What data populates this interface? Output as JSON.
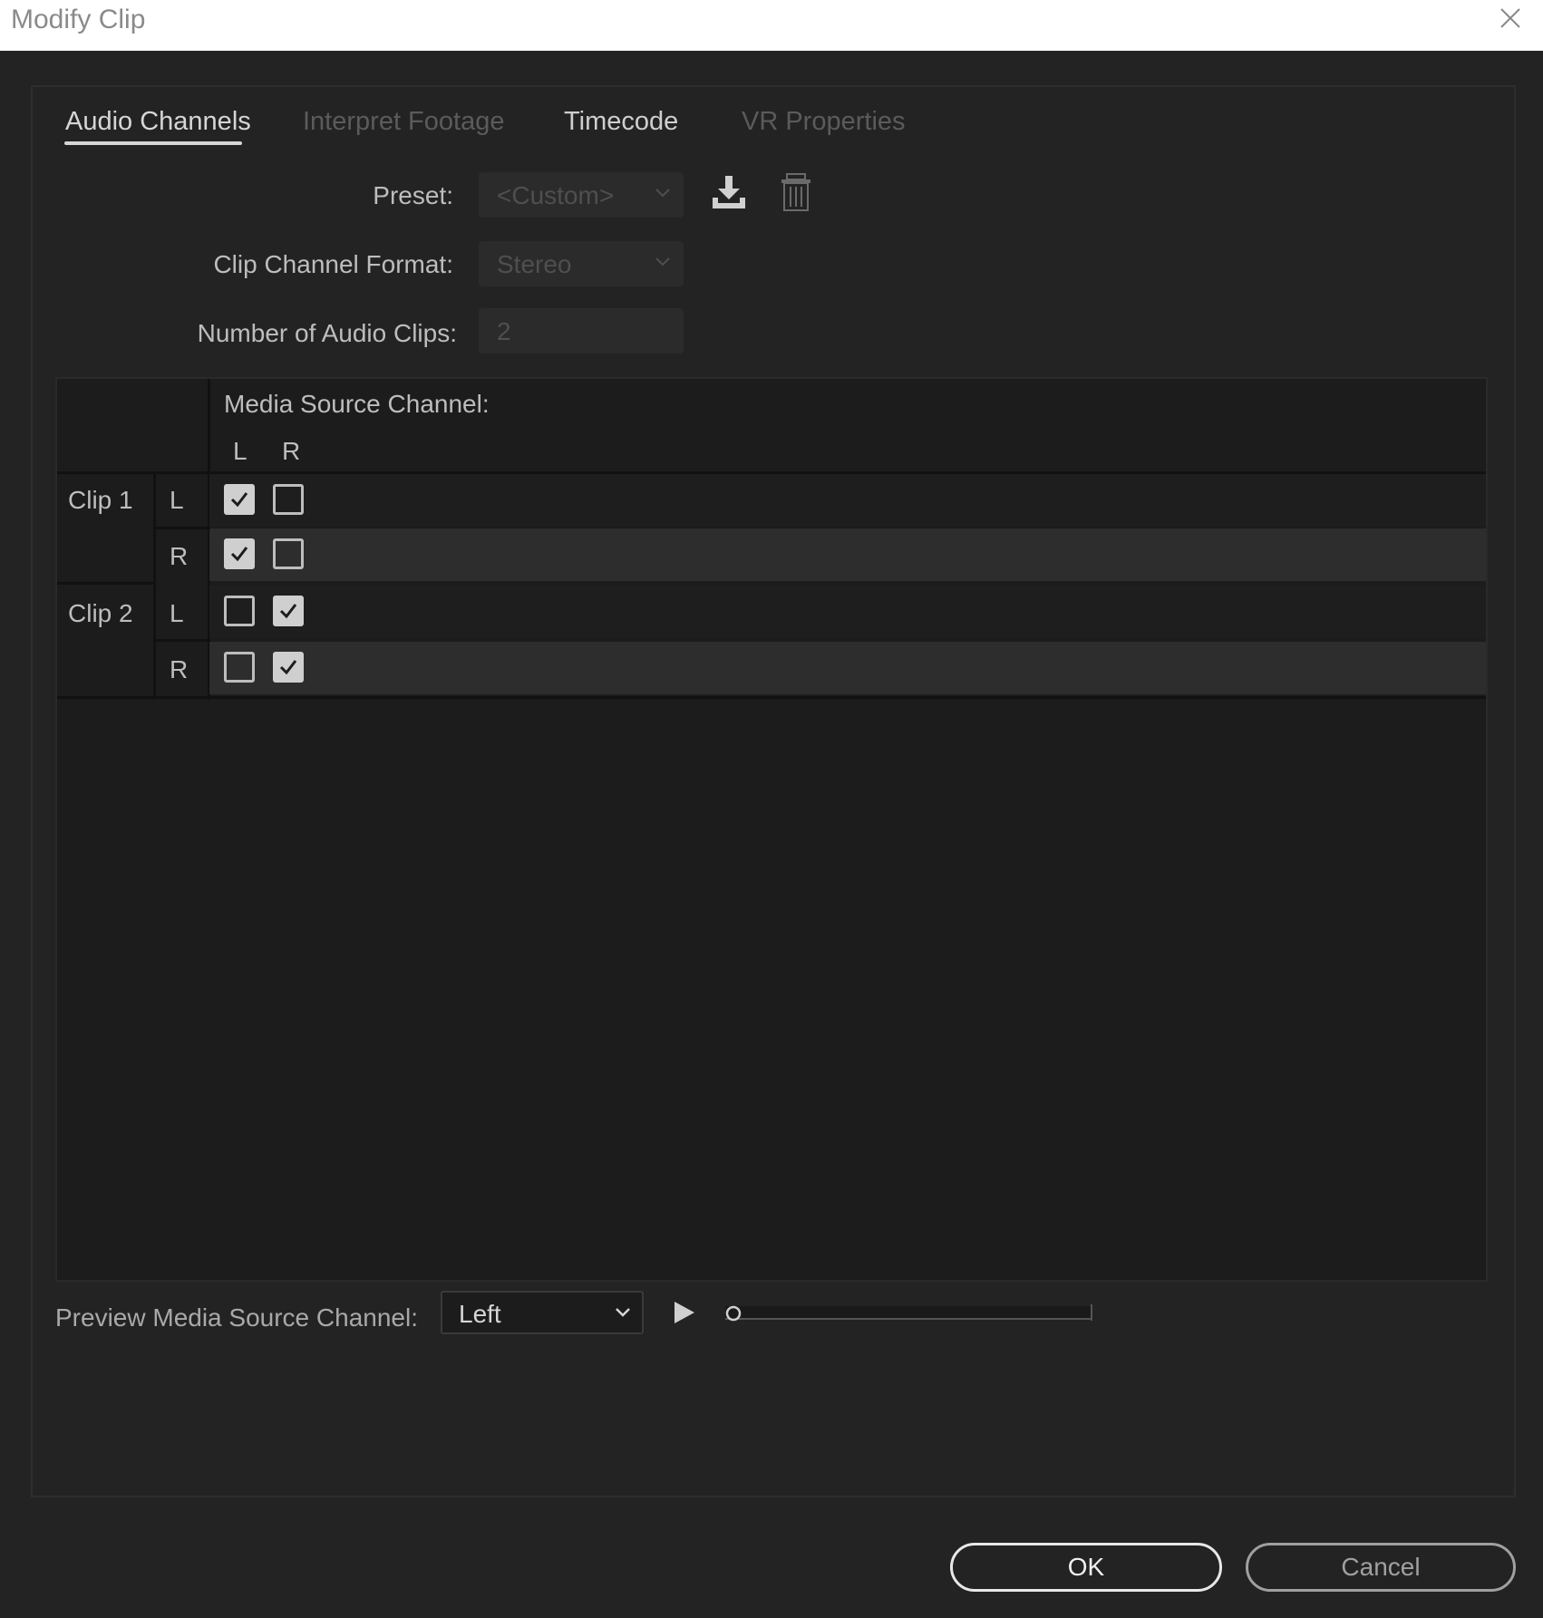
{
  "window": {
    "title": "Modify Clip",
    "close_icon": "close-icon"
  },
  "tabs": [
    {
      "label": "Audio Channels",
      "state": "active"
    },
    {
      "label": "Interpret Footage",
      "state": "disabled"
    },
    {
      "label": "Timecode",
      "state": "normal"
    },
    {
      "label": "VR Properties",
      "state": "disabled"
    }
  ],
  "form": {
    "preset": {
      "label": "Preset:",
      "value": "<Custom>"
    },
    "clip_channel_format": {
      "label": "Clip Channel Format:",
      "value": "Stereo"
    },
    "number_of_audio_clips": {
      "label": "Number of Audio Clips:",
      "value": "2"
    },
    "icons": [
      "save-preset-icon",
      "delete-preset-icon"
    ]
  },
  "matrix": {
    "header": "Media Source Channel:",
    "columns": [
      "L",
      "R"
    ],
    "clips": [
      {
        "label": "Clip 1",
        "channels": [
          {
            "channel": "L",
            "checked": [
              true,
              false
            ]
          },
          {
            "channel": "R",
            "checked": [
              true,
              false
            ]
          }
        ]
      },
      {
        "label": "Clip 2",
        "channels": [
          {
            "channel": "L",
            "checked": [
              false,
              true
            ]
          },
          {
            "channel": "R",
            "checked": [
              false,
              true
            ]
          }
        ]
      }
    ]
  },
  "preview": {
    "label": "Preview Media Source Channel:",
    "selected": "Left",
    "progress": 0.0
  },
  "buttons": {
    "ok": "OK",
    "cancel": "Cancel"
  },
  "colors": {
    "background": "#232323",
    "titlebar": "#ffffff",
    "panel_border": "#2e2e2e"
  }
}
